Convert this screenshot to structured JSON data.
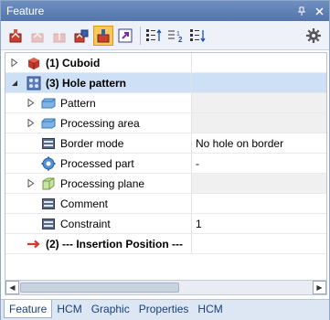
{
  "window": {
    "title": "Feature",
    "pin_icon": "pin-icon",
    "close_icon": "close-icon"
  },
  "toolbar": {
    "buttons": [
      {
        "icon": "feature-recalc-icon",
        "state": "enabled"
      },
      {
        "icon": "feature-recalc-disabled-icon",
        "state": "disabled"
      },
      {
        "icon": "feature-recalc-disabled-icon",
        "state": "disabled"
      },
      {
        "icon": "feature-recalc-all-icon",
        "state": "enabled"
      },
      {
        "icon": "feature-active-icon",
        "state": "active"
      },
      {
        "icon": "goto-arrow-icon",
        "state": "enabled"
      },
      {
        "icon": "sort-up-icon",
        "state": "enabled"
      },
      {
        "icon": "sort-numbered-icon",
        "state": "enabled"
      },
      {
        "icon": "sort-down-icon",
        "state": "enabled"
      },
      {
        "icon": "gear-icon",
        "state": "enabled"
      }
    ]
  },
  "tree": {
    "rows": [
      {
        "label": "(1) Cuboid",
        "value": "",
        "icon": "cuboid-icon",
        "expander": "collapsed",
        "bold": true,
        "level": 0
      },
      {
        "label": "(3) Hole pattern",
        "value": "",
        "icon": "hole-pattern-icon",
        "expander": "expanded",
        "bold": true,
        "level": 0,
        "selected": true
      },
      {
        "label": "Pattern",
        "value": "",
        "icon": "pattern-icon",
        "expander": "collapsed",
        "level": 1
      },
      {
        "label": "Processing area",
        "value": "",
        "icon": "processing-area-icon",
        "expander": "collapsed",
        "level": 1
      },
      {
        "label": "Border mode",
        "value": "No hole on border",
        "icon": "field-icon",
        "expander": "none",
        "level": 1
      },
      {
        "label": "Processed part",
        "value": "-",
        "icon": "processed-part-icon",
        "expander": "none",
        "level": 1
      },
      {
        "label": "Processing plane",
        "value": "",
        "icon": "processing-plane-icon",
        "expander": "collapsed",
        "level": 1
      },
      {
        "label": "Comment",
        "value": "",
        "icon": "field-icon",
        "expander": "none",
        "level": 1
      },
      {
        "label": "Constraint",
        "value": "1",
        "icon": "field-icon",
        "expander": "none",
        "level": 1
      },
      {
        "label": "(2) --- Insertion Position ---",
        "value": "",
        "icon": "insertion-arrow-icon",
        "expander": "none",
        "bold": true,
        "level": 0
      }
    ]
  },
  "tabs": [
    {
      "label": "Feature",
      "active": true
    },
    {
      "label": "HCM",
      "active": false
    },
    {
      "label": "Graphic",
      "active": false
    },
    {
      "label": "Properties",
      "active": false
    },
    {
      "label": "HCM",
      "active": false
    }
  ],
  "colors": {
    "titlebar": "#5a7bb2",
    "selection": "#cde0f5",
    "tab_text": "#1a3f7a",
    "accent_red": "#d23b2a"
  }
}
